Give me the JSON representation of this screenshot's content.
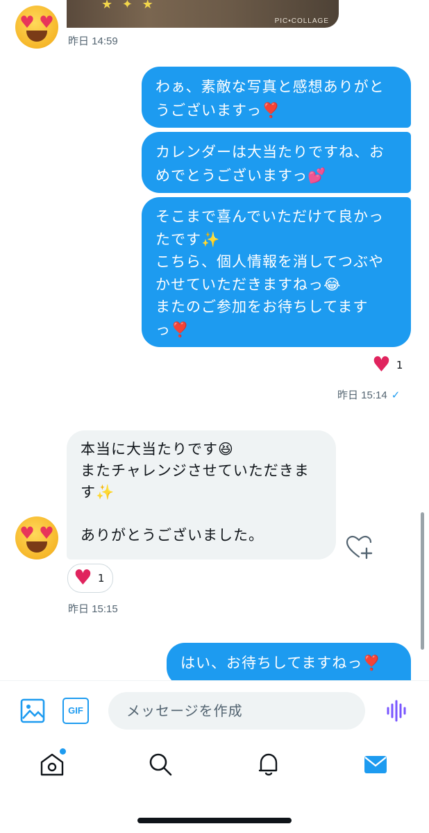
{
  "top_image": {
    "watermark": "PIC•COLLAGE"
  },
  "messages": [
    {
      "type": "timestamp",
      "text": "昨日 14:59"
    },
    {
      "type": "outgoing",
      "text": "わぁ、素敵な写真と感想ありがと\nうございますっ❣️"
    },
    {
      "type": "outgoing",
      "text": "カレンダーは大当たりですね、お\nめでとうございますっ💕"
    },
    {
      "type": "outgoing",
      "text": "そこまで喜んでいただけて良かっ\nたです✨\nこちら、個人情報を消してつぶや\nかせていただきますねっ😂\nまたのご参加をお待ちしてます\nっ❣️"
    },
    {
      "type": "reaction",
      "count": "1"
    },
    {
      "type": "timestamp",
      "text": "昨日 15:14",
      "status": "✓"
    },
    {
      "type": "incoming",
      "text": "本当に大当たりです😆\nまたチャレンジさせていただきま\nす✨\n\nありがとうございました。"
    },
    {
      "type": "reaction",
      "count": "1"
    },
    {
      "type": "timestamp",
      "text": "昨日 15:15"
    },
    {
      "type": "outgoing",
      "text": "はい、お待ちしてますねっ❣️"
    }
  ],
  "composer": {
    "placeholder": "メッセージを作成",
    "gif_label": "GIF"
  },
  "icons": {
    "image": "image-icon",
    "gif": "gif-icon",
    "voice": "voice-icon",
    "home": "home-icon",
    "search": "search-icon",
    "notifications": "bell-icon",
    "messages": "mail-icon"
  },
  "colors": {
    "accent": "#1d9bf0",
    "incoming": "#eff3f4",
    "heart": "#e0245e",
    "voice": "#7856ff"
  }
}
